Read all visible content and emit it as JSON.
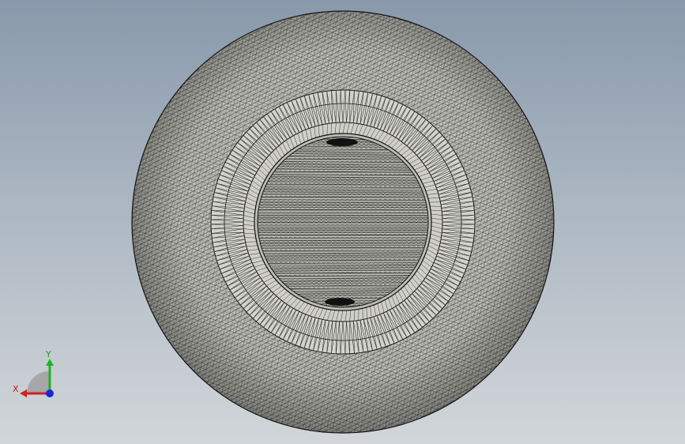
{
  "viewport": {
    "background_top": "#8999ab",
    "background_bottom": "#d2d6da"
  },
  "model": {
    "kind": "tessellated sphere with circular recess",
    "mesh_color": "#4a4a48",
    "surface_color": "#d3d3cc",
    "edge_color": "#1a1a1a"
  },
  "triad": {
    "x_label": "X",
    "y_label": "Y",
    "x_color": "#d42020",
    "y_color": "#22b022",
    "z_color": "#1a2ad0"
  }
}
